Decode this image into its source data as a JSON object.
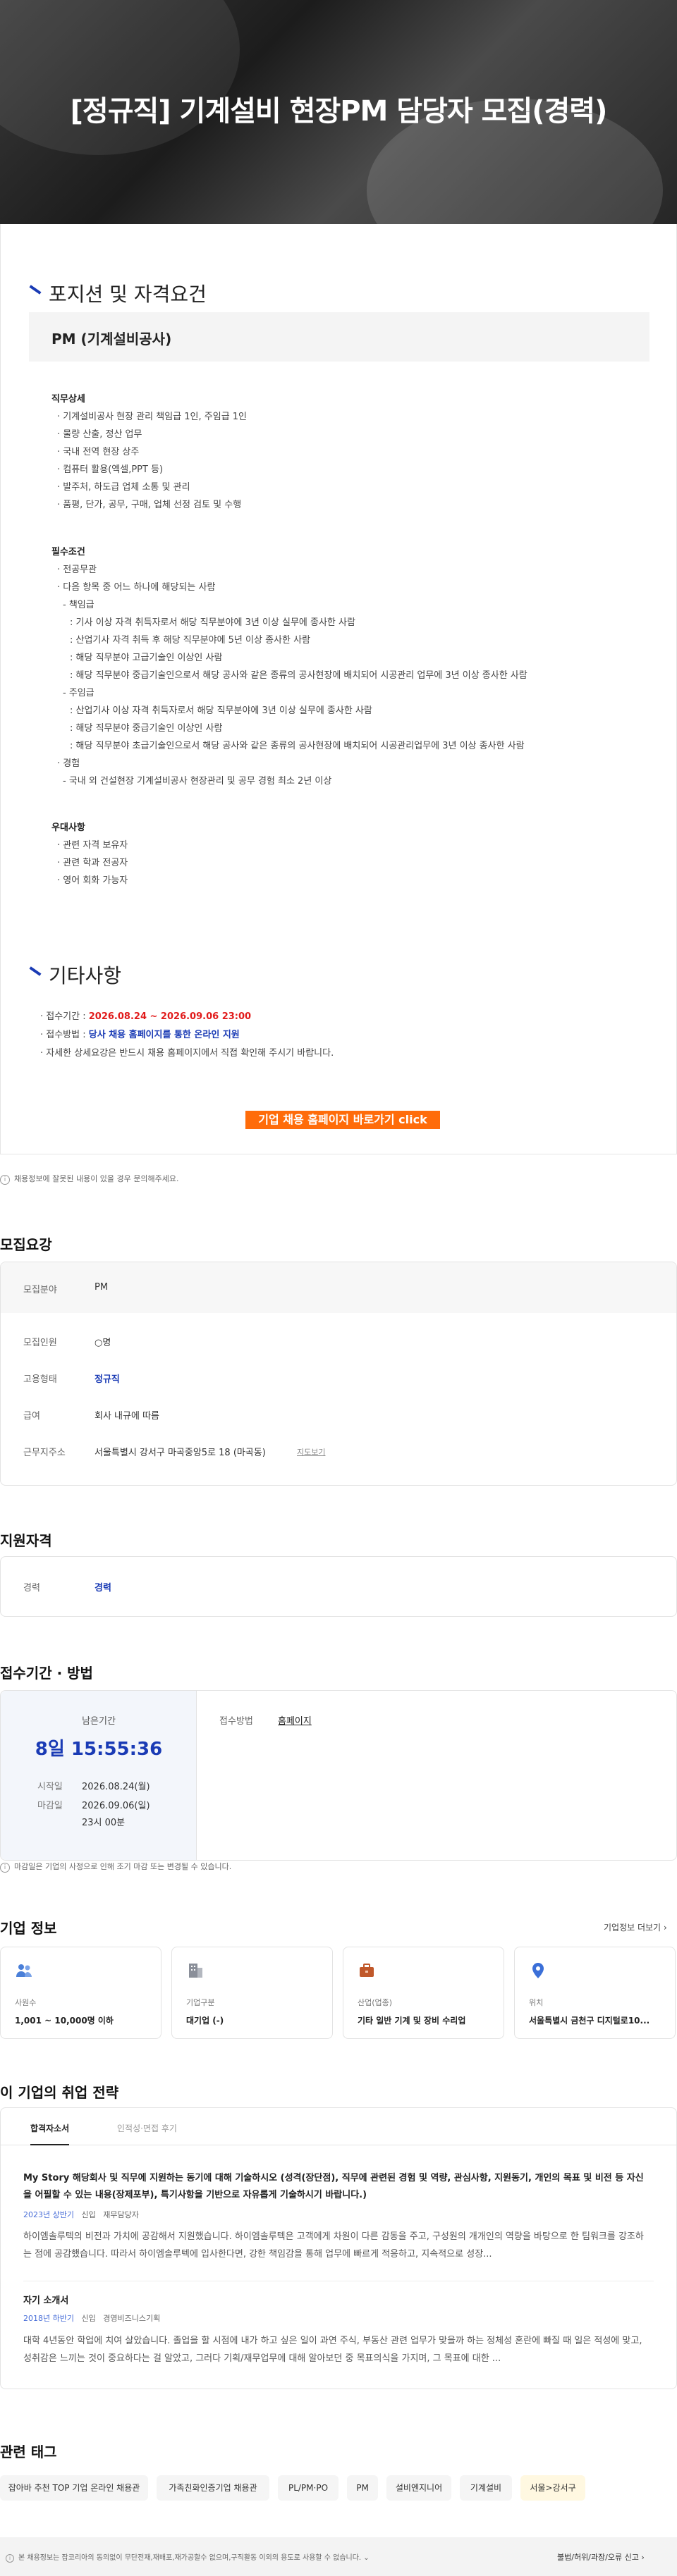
{
  "hero": {
    "title": "[정규직] 기계설비 현장PM 담당자 모집(경력)"
  },
  "position": {
    "heading": "포지션 및 자격요건",
    "role": "PM (기계설비공사)",
    "duties_title": "직무상세",
    "duties": [
      "· 기계설비공사 현장 관리 책임급 1인, 주임급 1인",
      "· 물량 산출, 정산 업무",
      "· 국내 전역 현장 상주",
      "· 컴퓨터 활용(엑셀,PPT 등)",
      "· 발주처, 하도급 업체 소통 및 관리",
      "· 품평, 단가, 공무, 구매, 업체 선정 검토 및 수행"
    ],
    "req_title": "필수조건",
    "reqs": [
      "· 전공무관",
      "· 다음 항목 중 어느 하나에 해당되는 사람",
      "- 책임급",
      "  : 기사 이상 자격 취득자로서 해당 직무분야에 3년 이상 실무에 종사한 사람",
      "  : 산업기사 자격 취득 후 해당 직무분야에 5년 이상 종사한 사람",
      "  : 해당 직무분야 고급기술인 이상인 사람",
      "  : 해당 직무분야 중급기술인으로서 해당 공사와 같은 종류의 공사현장에 배치되어 시공관리 업무에 3년 이상 종사한 사람",
      "- 주임급",
      "  : 산업기사 이상 자격 취득자로서 해당 직무분야에 3년 이상 실무에 종사한 사람",
      "  : 해당 직무분야 중급기술인 이상인 사람",
      "  : 해당 직무분야 초급기술인으로서 해당 공사와 같은 종류의 공사현장에 배치되어 시공관리업무에 3년 이상 종사한 사람",
      "· 경험",
      "- 국내 외 건설현장 기계설비공사 현장관리 및 공무 경험 최소 2년 이상"
    ],
    "pref_title": "우대사항",
    "prefs": [
      "· 관련 자격 보유자",
      "· 관련 학과 전공자",
      "· 영어 회화 가능자"
    ]
  },
  "etc": {
    "heading": "기타사항",
    "period_label": "· 접수기간 : ",
    "period": "2026.08.24 ~ 2026.09.06 23:00",
    "method_label": "· 접수방법 : ",
    "method": "당사 채용 홈페이지를 통한 온라인 지원",
    "detail": "· 자세한 상세요강은 반드시 채용 홈페이지에서 직접 확인해 주시기 바랍니다.",
    "button": "기업 채용 홈페이지 바로가기 click"
  },
  "notice1": "채용정보에 잘못된 내용이 있을 경우 문의해주세요.",
  "summary": {
    "heading": "모집요강",
    "rows": [
      {
        "k": "모집분야",
        "v": "PM"
      },
      {
        "k": "모집인원",
        "v": "○명"
      },
      {
        "k": "고용형태",
        "v": "정규직"
      },
      {
        "k": "급여",
        "v": "회사 내규에 따름"
      },
      {
        "k": "근무지주소",
        "v": "서울특별시 강서구 마곡중앙5로 18 (마곡동)"
      }
    ],
    "map_link": "지도보기"
  },
  "qual": {
    "heading": "지원자격",
    "k": "경력",
    "v": "경력"
  },
  "apply": {
    "heading": "접수기간 · 방법",
    "remain_label": "남은기간",
    "remain": "8일 15:55:36",
    "start_label": "시작일",
    "start": "2026.08.24(월)",
    "end_label": "마감일",
    "end": "2026.09.06(일)",
    "end_time": "23시 00분",
    "method_label": "접수방법",
    "method": "홈페이지",
    "notice": "마감일은 기업의 사정으로 인해 조기 마감 또는 변경될 수 있습니다."
  },
  "company": {
    "heading": "기업 정보",
    "more": "기업정보 더보기",
    "cards": [
      {
        "label": "사원수",
        "value": "1,001 ~ 10,000명 이하",
        "icon": "people-icon",
        "color": "#4a7fd8"
      },
      {
        "label": "기업구분",
        "value": "대기업 (-)",
        "icon": "building-icon",
        "color": "#8a8f99"
      },
      {
        "label": "산업(업종)",
        "value": "기타 일반 기계 및 장비 수리업",
        "icon": "briefcase-icon",
        "color": "#c0582a"
      },
      {
        "label": "위치",
        "value": "서울특별시 금천구 디지털로10...",
        "icon": "pin-icon",
        "color": "#3b6fd8"
      }
    ]
  },
  "strategy": {
    "heading": "이 기업의 취업 전략",
    "tabs": [
      "합격자소서",
      "인적성·면접 후기"
    ],
    "item1": {
      "title": "My Story 해당회사 및 직무에 지원하는 동기에 대해 기술하시오 (성격(장단점), 직무에 관련된 경험 및 역량, 관심사항, 지원동기, 개인의 목표 및 비전 등 자신을 어필할 수 있는 내용(장제포부), 특기사항을 기반으로 자유롭게 기술하시기 바랍니다.)",
      "meta1": "2023년 상반기",
      "meta2": "신입",
      "meta3": "재무담당자",
      "body": "하이엠솔루텍의 비전과 가치에 공감해서 지원했습니다. 하이엠솔루텍은 고객에게 차원이 다른 감동을 주고, 구성원의 개개인의 역량을 바탕으로 한 팀워크를 강조하는 점에 공감했습니다. 따라서 하이엠솔루텍에 입사한다면, 강한 책임감을 통해 업무에 빠르게 적응하고, 지속적으로 성장..."
    },
    "item2": {
      "title": "자기 소개서",
      "meta1": "2018년 하반기",
      "meta2": "신입",
      "meta3": "경영비즈니스기획",
      "body": "대학 4년동안 학업에 치여 살았습니다. 졸업을 할 시점에 내가 하고 싶은 일이 과연 주식, 부동산 관련 업무가 맞을까 하는 정체성 혼란에 빠질 때 일은 적성에 맞고, 성취감은 느끼는 것이 중요하다는 걸 알았고, 그러다 기획/재무업무에 대해 알아보던 중 목표의식을 가지며, 그 목표에 대한 ..."
    }
  },
  "tags": {
    "heading": "관련 태그",
    "items": [
      "잡아바 추천 TOP 기업 온라인 채용관",
      "가족친화인증기업 채용관",
      "PL/PM·PO",
      "PM",
      "설비엔지니어",
      "기계설비",
      "서울>강서구"
    ]
  },
  "footer": {
    "notice": "본 채용정보는 잡코리아의 동의없이 무단전재,재배포,재가공할수 없으며,구직활동 이외의 용도로 사용할 수 없습니다.",
    "report": "불법/허위/과장/오류 신고"
  }
}
